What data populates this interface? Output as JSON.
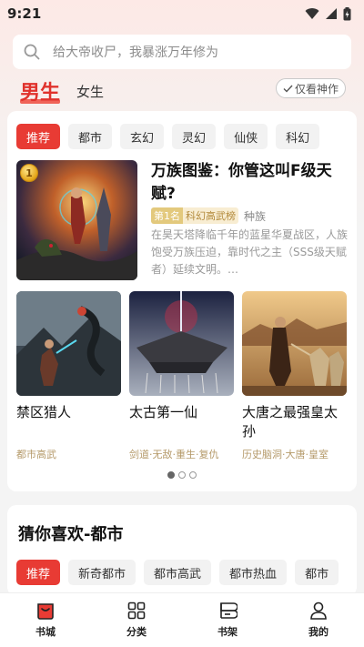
{
  "status": {
    "time": "9:21"
  },
  "search": {
    "placeholder": "给大帝收尸，我暴涨万年修为"
  },
  "gender_tabs": {
    "male": "男生",
    "female": "女生",
    "filter": "仅看神作"
  },
  "category_chips": [
    "推荐",
    "都市",
    "玄幻",
    "灵幻",
    "仙侠",
    "科幻"
  ],
  "featured": {
    "rank": "1",
    "title": "万族图鉴：你管这叫F级天赋?",
    "rank_label": "第1名",
    "rank_list": "科幻高武榜",
    "genre": "种族",
    "description": "在昊天塔降临千年的蓝星华夏战区，人族饱受万族压迫，靠时代之主（SSS级天赋者）延续文明。…"
  },
  "books": [
    {
      "title": "禁区猎人",
      "meta": "都市高武"
    },
    {
      "title": "太古第一仙",
      "meta": "剑道·无敌·重生·复仇"
    },
    {
      "title": "大唐之最强皇太孙",
      "meta": "历史脑洞·大唐·皇室"
    }
  ],
  "pager": {
    "count": 3,
    "active": 0
  },
  "guess": {
    "title": "猜你喜欢-都市",
    "chips": [
      "推荐",
      "新奇都市",
      "都市高武",
      "都市热血",
      "都市"
    ]
  },
  "nav": [
    {
      "label": "书城",
      "icon": "bookstore-icon"
    },
    {
      "label": "分类",
      "icon": "category-grid-icon"
    },
    {
      "label": "书架",
      "icon": "bookshelf-icon"
    },
    {
      "label": "我的",
      "icon": "profile-icon"
    }
  ],
  "colors": {
    "accent": "#e83b34",
    "gold": "#b59a6a"
  }
}
